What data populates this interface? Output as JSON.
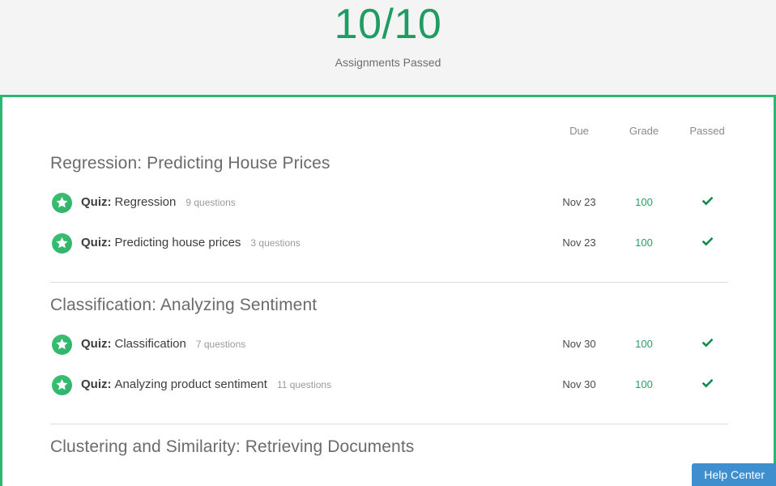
{
  "summary": {
    "score": "10/10",
    "caption": "Assignments Passed",
    "score_color": "#1f9c63"
  },
  "panel": {
    "accent_color": "#2bb673",
    "columns": {
      "due": "Due",
      "grade": "Grade",
      "passed": "Passed"
    }
  },
  "sections": [
    {
      "title": "Regression: Predicting House Prices",
      "items": [
        {
          "icon": "star-badge-icon",
          "kind": "Quiz:",
          "name": "Regression",
          "questions": "9 questions",
          "due": "Nov 23",
          "grade": "100",
          "passed_icon": "check-icon"
        },
        {
          "icon": "star-badge-icon",
          "kind": "Quiz:",
          "name": "Predicting house prices",
          "questions": "3 questions",
          "due": "Nov 23",
          "grade": "100",
          "passed_icon": "check-icon"
        }
      ]
    },
    {
      "title": "Classification: Analyzing Sentiment",
      "items": [
        {
          "icon": "star-badge-icon",
          "kind": "Quiz:",
          "name": "Classification",
          "questions": "7 questions",
          "due": "Nov 30",
          "grade": "100",
          "passed_icon": "check-icon"
        },
        {
          "icon": "star-badge-icon",
          "kind": "Quiz:",
          "name": "Analyzing product sentiment",
          "questions": "11 questions",
          "due": "Nov 30",
          "grade": "100",
          "passed_icon": "check-icon"
        }
      ]
    },
    {
      "title": "Clustering and Similarity: Retrieving Documents",
      "items": []
    }
  ],
  "help": {
    "label": "Help Center",
    "color": "#3f8fce"
  }
}
